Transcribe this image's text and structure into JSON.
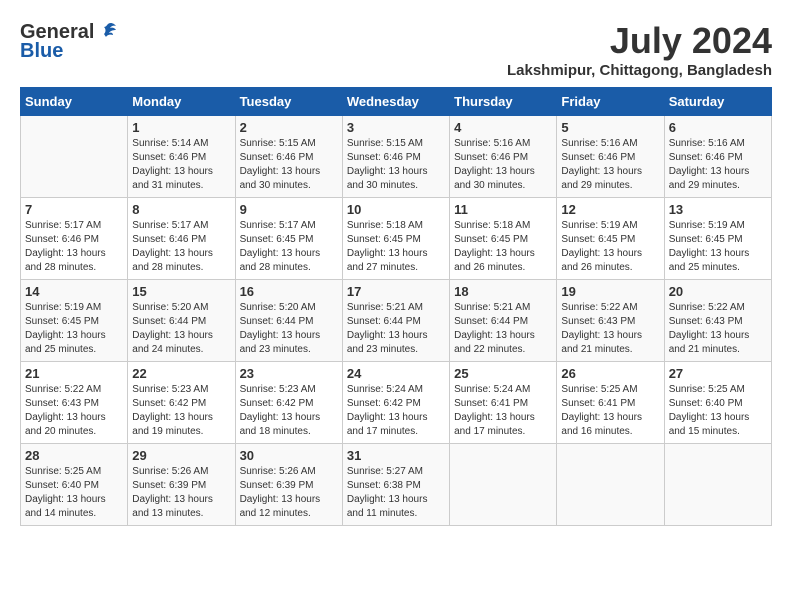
{
  "header": {
    "logo_general": "General",
    "logo_blue": "Blue",
    "title": "July 2024",
    "location": "Lakshmipur, Chittagong, Bangladesh"
  },
  "calendar": {
    "days_of_week": [
      "Sunday",
      "Monday",
      "Tuesday",
      "Wednesday",
      "Thursday",
      "Friday",
      "Saturday"
    ],
    "weeks": [
      [
        {
          "day": "",
          "sunrise": "",
          "sunset": "",
          "daylight": ""
        },
        {
          "day": "1",
          "sunrise": "Sunrise: 5:14 AM",
          "sunset": "Sunset: 6:46 PM",
          "daylight": "Daylight: 13 hours and 31 minutes."
        },
        {
          "day": "2",
          "sunrise": "Sunrise: 5:15 AM",
          "sunset": "Sunset: 6:46 PM",
          "daylight": "Daylight: 13 hours and 30 minutes."
        },
        {
          "day": "3",
          "sunrise": "Sunrise: 5:15 AM",
          "sunset": "Sunset: 6:46 PM",
          "daylight": "Daylight: 13 hours and 30 minutes."
        },
        {
          "day": "4",
          "sunrise": "Sunrise: 5:16 AM",
          "sunset": "Sunset: 6:46 PM",
          "daylight": "Daylight: 13 hours and 30 minutes."
        },
        {
          "day": "5",
          "sunrise": "Sunrise: 5:16 AM",
          "sunset": "Sunset: 6:46 PM",
          "daylight": "Daylight: 13 hours and 29 minutes."
        },
        {
          "day": "6",
          "sunrise": "Sunrise: 5:16 AM",
          "sunset": "Sunset: 6:46 PM",
          "daylight": "Daylight: 13 hours and 29 minutes."
        }
      ],
      [
        {
          "day": "7",
          "sunrise": "Sunrise: 5:17 AM",
          "sunset": "Sunset: 6:46 PM",
          "daylight": "Daylight: 13 hours and 28 minutes."
        },
        {
          "day": "8",
          "sunrise": "Sunrise: 5:17 AM",
          "sunset": "Sunset: 6:46 PM",
          "daylight": "Daylight: 13 hours and 28 minutes."
        },
        {
          "day": "9",
          "sunrise": "Sunrise: 5:17 AM",
          "sunset": "Sunset: 6:45 PM",
          "daylight": "Daylight: 13 hours and 28 minutes."
        },
        {
          "day": "10",
          "sunrise": "Sunrise: 5:18 AM",
          "sunset": "Sunset: 6:45 PM",
          "daylight": "Daylight: 13 hours and 27 minutes."
        },
        {
          "day": "11",
          "sunrise": "Sunrise: 5:18 AM",
          "sunset": "Sunset: 6:45 PM",
          "daylight": "Daylight: 13 hours and 26 minutes."
        },
        {
          "day": "12",
          "sunrise": "Sunrise: 5:19 AM",
          "sunset": "Sunset: 6:45 PM",
          "daylight": "Daylight: 13 hours and 26 minutes."
        },
        {
          "day": "13",
          "sunrise": "Sunrise: 5:19 AM",
          "sunset": "Sunset: 6:45 PM",
          "daylight": "Daylight: 13 hours and 25 minutes."
        }
      ],
      [
        {
          "day": "14",
          "sunrise": "Sunrise: 5:19 AM",
          "sunset": "Sunset: 6:45 PM",
          "daylight": "Daylight: 13 hours and 25 minutes."
        },
        {
          "day": "15",
          "sunrise": "Sunrise: 5:20 AM",
          "sunset": "Sunset: 6:44 PM",
          "daylight": "Daylight: 13 hours and 24 minutes."
        },
        {
          "day": "16",
          "sunrise": "Sunrise: 5:20 AM",
          "sunset": "Sunset: 6:44 PM",
          "daylight": "Daylight: 13 hours and 23 minutes."
        },
        {
          "day": "17",
          "sunrise": "Sunrise: 5:21 AM",
          "sunset": "Sunset: 6:44 PM",
          "daylight": "Daylight: 13 hours and 23 minutes."
        },
        {
          "day": "18",
          "sunrise": "Sunrise: 5:21 AM",
          "sunset": "Sunset: 6:44 PM",
          "daylight": "Daylight: 13 hours and 22 minutes."
        },
        {
          "day": "19",
          "sunrise": "Sunrise: 5:22 AM",
          "sunset": "Sunset: 6:43 PM",
          "daylight": "Daylight: 13 hours and 21 minutes."
        },
        {
          "day": "20",
          "sunrise": "Sunrise: 5:22 AM",
          "sunset": "Sunset: 6:43 PM",
          "daylight": "Daylight: 13 hours and 21 minutes."
        }
      ],
      [
        {
          "day": "21",
          "sunrise": "Sunrise: 5:22 AM",
          "sunset": "Sunset: 6:43 PM",
          "daylight": "Daylight: 13 hours and 20 minutes."
        },
        {
          "day": "22",
          "sunrise": "Sunrise: 5:23 AM",
          "sunset": "Sunset: 6:42 PM",
          "daylight": "Daylight: 13 hours and 19 minutes."
        },
        {
          "day": "23",
          "sunrise": "Sunrise: 5:23 AM",
          "sunset": "Sunset: 6:42 PM",
          "daylight": "Daylight: 13 hours and 18 minutes."
        },
        {
          "day": "24",
          "sunrise": "Sunrise: 5:24 AM",
          "sunset": "Sunset: 6:42 PM",
          "daylight": "Daylight: 13 hours and 17 minutes."
        },
        {
          "day": "25",
          "sunrise": "Sunrise: 5:24 AM",
          "sunset": "Sunset: 6:41 PM",
          "daylight": "Daylight: 13 hours and 17 minutes."
        },
        {
          "day": "26",
          "sunrise": "Sunrise: 5:25 AM",
          "sunset": "Sunset: 6:41 PM",
          "daylight": "Daylight: 13 hours and 16 minutes."
        },
        {
          "day": "27",
          "sunrise": "Sunrise: 5:25 AM",
          "sunset": "Sunset: 6:40 PM",
          "daylight": "Daylight: 13 hours and 15 minutes."
        }
      ],
      [
        {
          "day": "28",
          "sunrise": "Sunrise: 5:25 AM",
          "sunset": "Sunset: 6:40 PM",
          "daylight": "Daylight: 13 hours and 14 minutes."
        },
        {
          "day": "29",
          "sunrise": "Sunrise: 5:26 AM",
          "sunset": "Sunset: 6:39 PM",
          "daylight": "Daylight: 13 hours and 13 minutes."
        },
        {
          "day": "30",
          "sunrise": "Sunrise: 5:26 AM",
          "sunset": "Sunset: 6:39 PM",
          "daylight": "Daylight: 13 hours and 12 minutes."
        },
        {
          "day": "31",
          "sunrise": "Sunrise: 5:27 AM",
          "sunset": "Sunset: 6:38 PM",
          "daylight": "Daylight: 13 hours and 11 minutes."
        },
        {
          "day": "",
          "sunrise": "",
          "sunset": "",
          "daylight": ""
        },
        {
          "day": "",
          "sunrise": "",
          "sunset": "",
          "daylight": ""
        },
        {
          "day": "",
          "sunrise": "",
          "sunset": "",
          "daylight": ""
        }
      ]
    ]
  }
}
